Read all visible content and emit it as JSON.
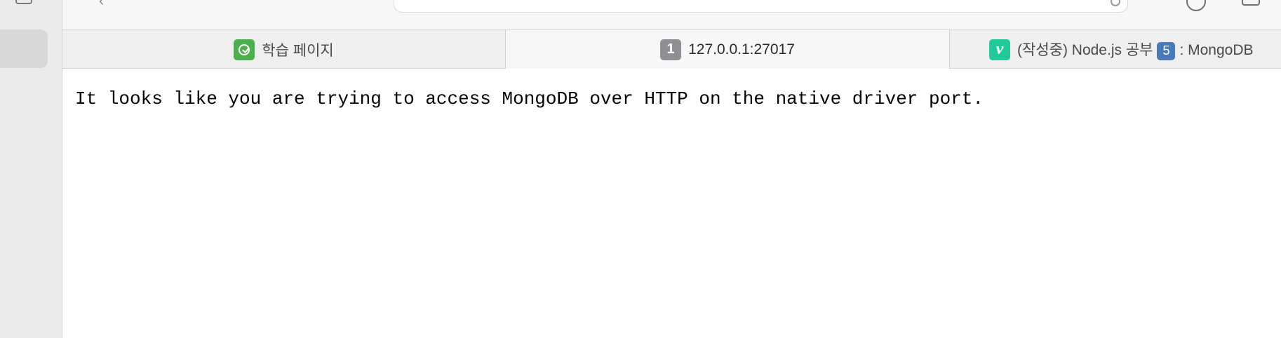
{
  "tabs": [
    {
      "favicon": "study-icon",
      "label": "학습 페이지"
    },
    {
      "favicon": "number-badge-icon",
      "favicon_text": "1",
      "label": "127.0.0.1:27017",
      "active": true
    },
    {
      "favicon": "velog-icon",
      "favicon_text": "v",
      "label_prefix": "(작성중) Node.js 공부",
      "label_badge": "5",
      "label_suffix": ": MongoDB"
    }
  ],
  "page": {
    "text": "It looks like you are trying to access MongoDB over HTTP on the native driver port."
  },
  "colors": {
    "study_favicon": "#4caf50",
    "number_favicon": "#8e8e93",
    "velog_favicon": "#20c997",
    "emoji_badge": "#4a79b8"
  }
}
